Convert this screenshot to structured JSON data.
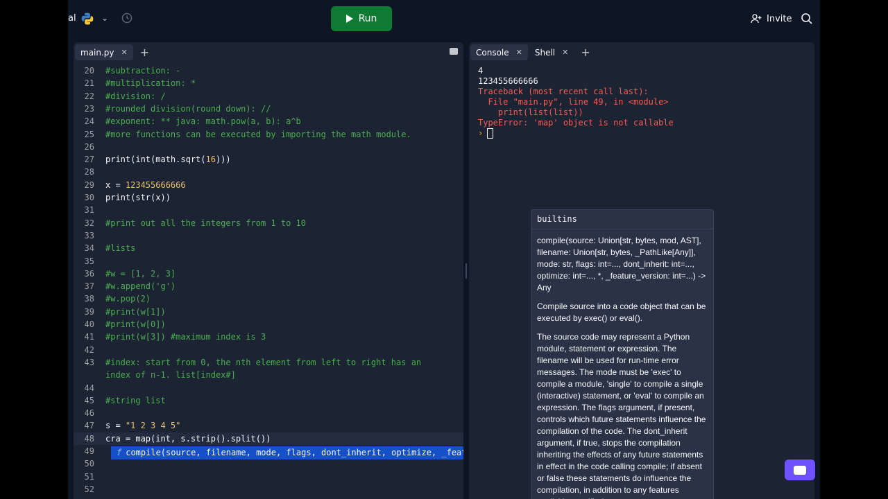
{
  "topbar": {
    "project_fragment": "al",
    "run_label": "Run",
    "invite_label": "Invite"
  },
  "editor": {
    "tab_label": "main.py",
    "lines": [
      {
        "n": "20",
        "parts": [
          {
            "t": "#subtraction: -",
            "k": "c"
          }
        ]
      },
      {
        "n": "21",
        "parts": [
          {
            "t": "#multiplication: *",
            "k": "c"
          }
        ]
      },
      {
        "n": "22",
        "parts": [
          {
            "t": "#division: /",
            "k": "c"
          }
        ]
      },
      {
        "n": "23",
        "parts": [
          {
            "t": "#rounded division(round down): //",
            "k": "c"
          }
        ]
      },
      {
        "n": "24",
        "parts": [
          {
            "t": "#exponent: ** java: math.pow(a, b): a^b",
            "k": "c"
          }
        ]
      },
      {
        "n": "25",
        "parts": [
          {
            "t": "#more functions can be executed by importing the math module.",
            "k": "c"
          }
        ]
      },
      {
        "n": "26",
        "parts": []
      },
      {
        "n": "27",
        "parts": [
          {
            "t": "print(int(math.sqrt(",
            "k": "f"
          },
          {
            "t": "16",
            "k": "n"
          },
          {
            "t": ")))",
            "k": "f"
          }
        ]
      },
      {
        "n": "28",
        "parts": []
      },
      {
        "n": "29",
        "parts": [
          {
            "t": "x = ",
            "k": "f"
          },
          {
            "t": "123455666666",
            "k": "n"
          }
        ]
      },
      {
        "n": "30",
        "parts": [
          {
            "t": "print(str(x))",
            "k": "f"
          }
        ]
      },
      {
        "n": "31",
        "parts": []
      },
      {
        "n": "32",
        "parts": [
          {
            "t": "#print out all the integers from 1 to 10",
            "k": "c"
          }
        ]
      },
      {
        "n": "33",
        "parts": []
      },
      {
        "n": "34",
        "parts": [
          {
            "t": "#lists",
            "k": "c"
          }
        ]
      },
      {
        "n": "35",
        "parts": []
      },
      {
        "n": "36",
        "parts": [
          {
            "t": "#w = [1, 2, 3]",
            "k": "c"
          }
        ]
      },
      {
        "n": "37",
        "parts": [
          {
            "t": "#w.append('g')",
            "k": "c"
          }
        ]
      },
      {
        "n": "38",
        "parts": [
          {
            "t": "#w.pop(2)",
            "k": "c"
          }
        ]
      },
      {
        "n": "39",
        "parts": [
          {
            "t": "#print(w[1])",
            "k": "c"
          }
        ]
      },
      {
        "n": "40",
        "parts": [
          {
            "t": "#print(w[0])",
            "k": "c"
          }
        ]
      },
      {
        "n": "41",
        "parts": [
          {
            "t": "#print(w[3]) #maximum index is 3",
            "k": "c"
          }
        ]
      },
      {
        "n": "42",
        "parts": []
      },
      {
        "n": "43",
        "parts": [
          {
            "t": "#index: start from 0, the nth element from left to right has an",
            "k": "c"
          }
        ]
      },
      {
        "n": "",
        "parts": [
          {
            "t": "index of n-1. list[index#]",
            "k": "c"
          }
        ]
      },
      {
        "n": "44",
        "parts": []
      },
      {
        "n": "45",
        "parts": [
          {
            "t": "#string list",
            "k": "c"
          }
        ]
      },
      {
        "n": "46",
        "parts": []
      },
      {
        "n": "47",
        "parts": [
          {
            "t": "s = ",
            "k": "f"
          },
          {
            "t": "\"1 2 3 4 5\"",
            "k": "s"
          }
        ]
      },
      {
        "n": "48",
        "parts": [
          {
            "t": "cra = map(int, s.strip().split())",
            "k": "f"
          }
        ]
      },
      {
        "n": "49",
        "parts": []
      },
      {
        "n": "50",
        "parts": []
      },
      {
        "n": "51",
        "parts": []
      },
      {
        "n": "52",
        "parts": []
      }
    ],
    "autocomplete": {
      "kind_icon": "f",
      "text": "compile(source, filename, mode, flags, dont_inherit, optimize, _feature_versio…"
    }
  },
  "console": {
    "tabs": [
      "Console",
      "Shell"
    ],
    "output": [
      {
        "t": "4",
        "k": "w"
      },
      {
        "t": "123455666666",
        "k": "w"
      },
      {
        "t": "Traceback (most recent call last):",
        "k": "e"
      },
      {
        "t": "  File \"main.py\", line 49, in <module>",
        "k": "e"
      },
      {
        "t": "    print(list(list))",
        "k": "e"
      },
      {
        "t": "TypeError: 'map' object is not callable",
        "k": "e"
      }
    ],
    "prompt": "›"
  },
  "doc_popup": {
    "title": "builtins",
    "signature": "compile(source: Union[str, bytes, mod, AST], filename: Union[str, bytes, _PathLike[Any]], mode: str, flags: int=..., dont_inherit: int=..., optimize: int=..., *, _feature_version: int=...) -> Any",
    "summary": "Compile source into a code object that can be executed by exec() or eval().",
    "body": "The source code may represent a Python module, statement or expression. The filename will be used for run-time error messages. The mode must be 'exec' to compile a module, 'single' to compile a single (interactive) statement, or 'eval' to compile an expression. The flags argument, if present, controls which future statements influence the compilation of the code. The dont_inherit argument, if true, stops the compilation inheriting the effects of any future statements in effect in the code calling compile; if absent or false these statements do influence the compilation, in addition to any features explicitly specified."
  },
  "colors": {
    "bg": "#0e1525",
    "panel": "#1c2333",
    "run": "#0f7a31",
    "comment": "#4caf50",
    "string": "#e9c46a",
    "error": "#f65c52",
    "accent": "#6f52ff"
  },
  "icons": [
    "python-icon",
    "chevron-down-icon",
    "history-icon",
    "play-icon",
    "add-user-icon",
    "search-icon",
    "close-icon",
    "plus-icon",
    "menu-icon",
    "function-icon",
    "chat-icon"
  ]
}
